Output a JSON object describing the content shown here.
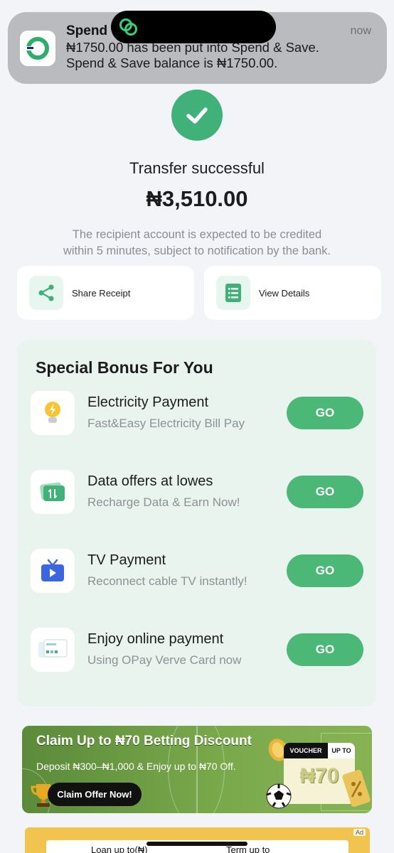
{
  "notification": {
    "app_title": "Spend",
    "time": "now",
    "line1": "₦1750.00 has been put into Spend & Save.",
    "line2": "Spend & Save balance is ₦1750.00."
  },
  "transfer": {
    "status": "Transfer successful",
    "amount": "₦3,510.00",
    "note_line1": "The recipient account is expected to be credited",
    "note_line2": "within 5 minutes, subject to notification by the bank."
  },
  "actions": [
    {
      "label": "Share Receipt",
      "icon": "share-icon"
    },
    {
      "label": "View Details",
      "icon": "list-icon"
    }
  ],
  "bonus": {
    "title": "Special Bonus For You",
    "items": [
      {
        "title": "Electricity Payment",
        "subtitle": "Fast&Easy Electricity Bill Pay",
        "button": "GO",
        "icon": "lightbulb-icon"
      },
      {
        "title": "Data offers at lowes",
        "subtitle": "Recharge Data & Earn Now!",
        "button": "GO",
        "icon": "data-card-icon"
      },
      {
        "title": "TV Payment",
        "subtitle": "Reconnect cable TV instantly!",
        "button": "GO",
        "icon": "tv-icon"
      },
      {
        "title": "Enjoy online payment",
        "subtitle": "Using OPay Verve Card now",
        "button": "GO",
        "icon": "card-icon"
      }
    ]
  },
  "promo": {
    "title": "Claim Up to ₦70 Betting Discount",
    "subtitle": "Deposit ₦300–₦1,000 & Enjoy up to ₦70 Off.",
    "button": "Claim Offer Now!",
    "voucher_label": "VOUCHER",
    "voucher_upto": "UP TO",
    "voucher_amount": "₦70"
  },
  "loan_ad": {
    "label1": "Loan up to(₦)",
    "label2": "Term up to",
    "ad_tag": "Ad"
  },
  "colors": {
    "brand_green": "#3fb179",
    "button_green": "#4cb878"
  }
}
